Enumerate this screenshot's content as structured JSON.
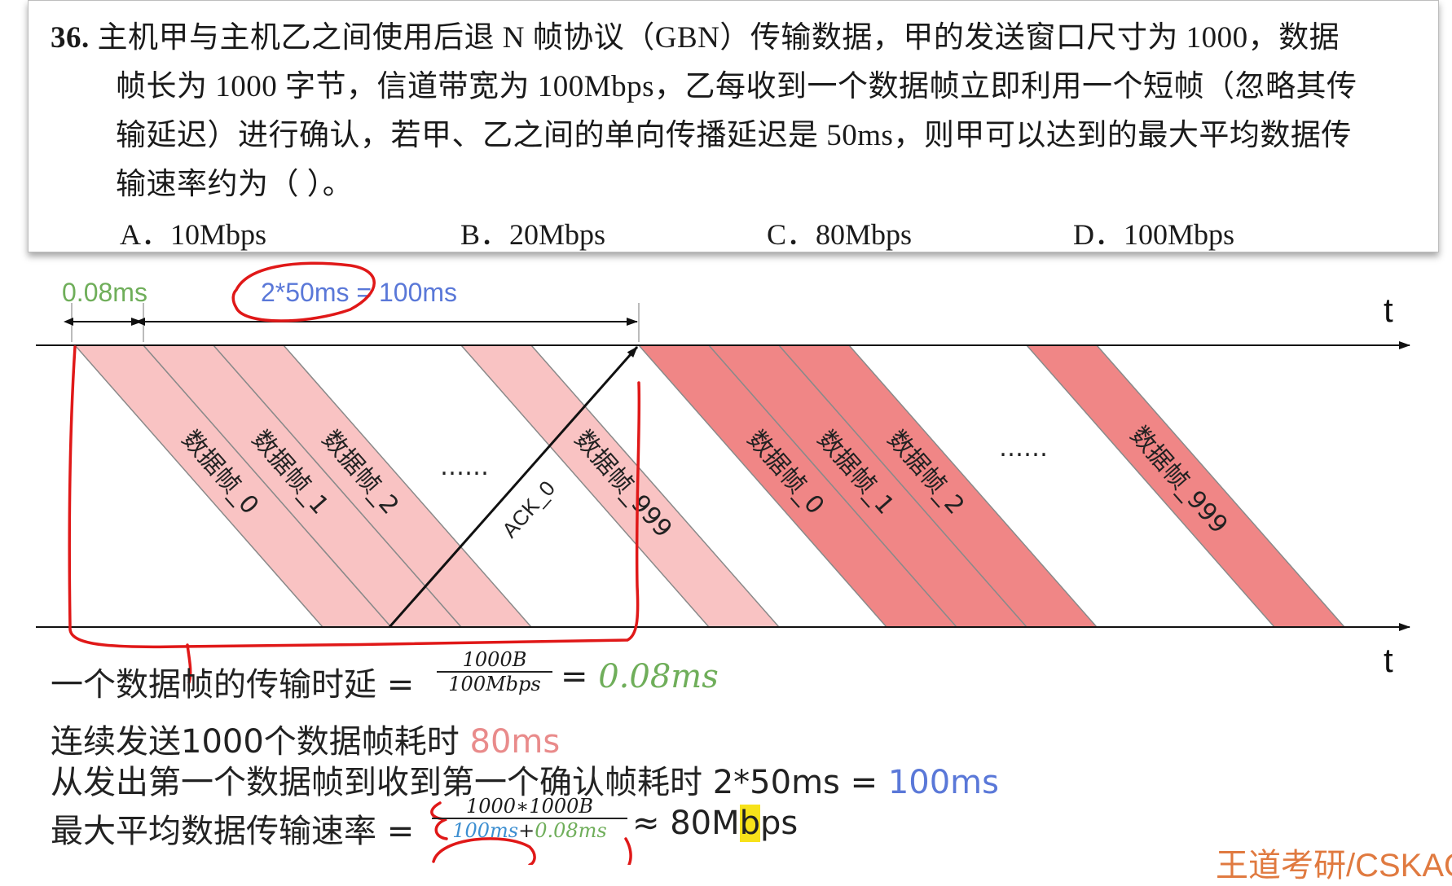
{
  "question": {
    "number": "36.",
    "lines": [
      "主机甲与主机乙之间使用后退 N 帧协议（GBN）传输数据，甲的发送窗口尺寸为 1000，数据",
      "帧长为 1000 字节，信道带宽为 100Mbps，乙每收到一个数据帧立即利用一个短帧（忽略其传",
      "输延迟）进行确认，若甲、乙之间的单向传播延迟是 50ms，则甲可以达到的最大平均数据传",
      "输速率约为（      ）。"
    ],
    "options": [
      "A．10Mbps",
      "B．20Mbps",
      "C．80Mbps",
      "D．100Mbps"
    ]
  },
  "diagram": {
    "label_tx": "0.08ms",
    "label_rtt": "2*50ms = 100ms",
    "axis_label_top": "t",
    "axis_label_bottom": "t",
    "frames_first": [
      "数据帧_0",
      "数据帧_1",
      "数据帧_2",
      "数据帧_999"
    ],
    "frames_second": [
      "数据帧_0",
      "数据帧_1",
      "数据帧_2",
      "数据帧_999"
    ],
    "ellipsis": "……",
    "ack_label": "ACK_0"
  },
  "calc": {
    "line1_prefix": "一个数据帧的传输时延 =",
    "line1_num": "1000B",
    "line1_den": "100Mbps",
    "line1_eq": "=",
    "line1_result": "0.08ms",
    "line2_prefix": "连续发送1000个数据帧耗时",
    "line2_value": "80ms",
    "line3_prefix": "从发出第一个数据帧到收到第一个确认帧耗时",
    "line3_expr": "2*50ms =",
    "line3_value": "100ms",
    "line4_prefix": "最大平均数据传输速率 =",
    "line4_num": "1000∗1000B",
    "line4_den_a": "100ms",
    "line4_den_plus": "+",
    "line4_den_b": "0.08ms",
    "line4_result_a": "≈ 80M",
    "line4_result_b": "b",
    "line4_result_c": "ps"
  },
  "watermark": "王道考研/CSKAO",
  "colors": {
    "green": "#6fae5a",
    "blue": "#5a78d8",
    "pink_label": "#e98b8b",
    "light_frame": "#f9c3c3",
    "dark_frame": "#f08686",
    "frame_border": "#8a8a8a",
    "annotation_red": "#e01818",
    "highlight": "#f7e21a"
  }
}
